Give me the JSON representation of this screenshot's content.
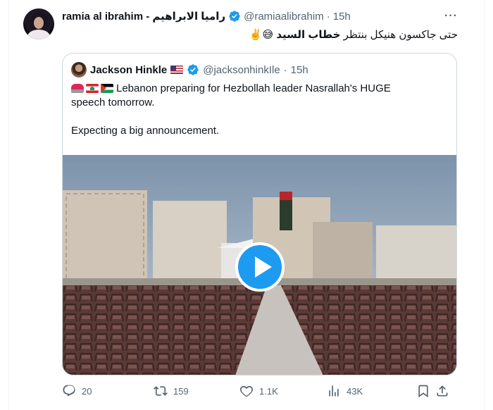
{
  "tweet": {
    "author": {
      "display_name": "ramia al ibrahim - راميا الابراهيم",
      "handle": "@ramiaalibrahim",
      "separator": "·",
      "time": "15h"
    },
    "text_plain": "حتى جاكسون هنيكل بنتظر ",
    "text_bold": "خطاب السيد",
    "text_emoji": "😅✌️",
    "more_icon": "more-horizontal-icon"
  },
  "quote": {
    "author": {
      "display_name": "Jackson Hinkle",
      "flag": "🇺🇸",
      "handle": "@jacksonhinkIle",
      "separator": "·",
      "time": "15h"
    },
    "line1": "Lebanon preparing for Hezbollah leader Nasrallah's HUGE",
    "line2": "speech tomorrow.",
    "line3": "Expecting a big announcement.",
    "flags": [
      "siren-icon",
      "lebanon-flag-icon",
      "palestine-flag-icon"
    ]
  },
  "actions": {
    "reply_count": "20",
    "retweet_count": "159",
    "like_count": "1.1K",
    "views_count": "43K"
  },
  "colors": {
    "accent": "#1d9bf0",
    "muted": "#536471",
    "text": "#0f1419",
    "border": "#cfd9de"
  }
}
